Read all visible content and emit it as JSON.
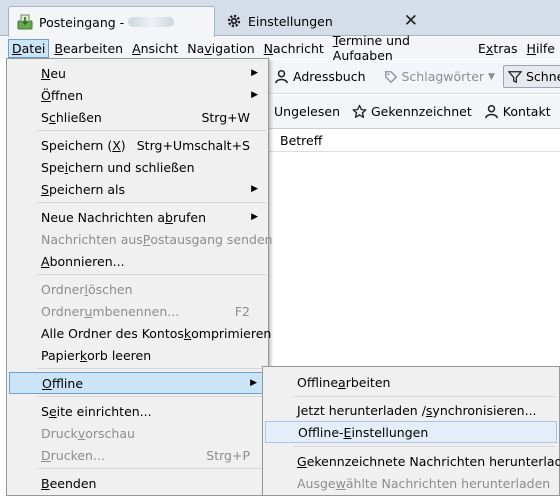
{
  "tabs": [
    {
      "label": "Posteingang -",
      "icon": "inbox-download-icon"
    },
    {
      "label": "Einstellungen",
      "icon": "gear-icon",
      "close": "✕"
    }
  ],
  "menubar": {
    "items": [
      {
        "pre": "",
        "u": "D",
        "post": "atei"
      },
      {
        "pre": "",
        "u": "B",
        "post": "earbeiten"
      },
      {
        "pre": "",
        "u": "A",
        "post": "nsicht"
      },
      {
        "pre": "Na",
        "u": "v",
        "post": "igation"
      },
      {
        "pre": "",
        "u": "N",
        "post": "achricht"
      },
      {
        "pre": "",
        "u": "T",
        "post": "ermine und Aufgaben"
      },
      {
        "pre": "E",
        "u": "x",
        "post": "tras"
      },
      {
        "pre": "",
        "u": "H",
        "post": "ilfe"
      }
    ]
  },
  "toolbar": {
    "addressbook": "Adressbuch",
    "tags": "Schlagwörter",
    "quickfilter": "Schnellfi",
    "unread": "Ungelesen",
    "starred": "Gekennzeichnet",
    "contact": "Kontakt"
  },
  "columns": {
    "subject": "Betreff"
  },
  "file_menu": {
    "items": [
      {
        "pre": "",
        "u": "N",
        "post": "eu",
        "shortcut": "",
        "submenu": true,
        "disabled": false
      },
      {
        "pre": "",
        "u": "Ö",
        "post": "ffnen",
        "shortcut": "",
        "submenu": true,
        "disabled": false
      },
      {
        "pre": "S",
        "u": "c",
        "post": "hließen",
        "shortcut": "Strg+W",
        "submenu": false,
        "disabled": false
      },
      {
        "pre": "Speichern (",
        "u": "X",
        "post": ")",
        "shortcut": "Strg+Umschalt+S",
        "submenu": false,
        "disabled": false
      },
      {
        "pre": "Spe",
        "u": "i",
        "post": "chern und schließen",
        "shortcut": "",
        "submenu": false,
        "disabled": false
      },
      {
        "pre": "",
        "u": "S",
        "post": "peichern als",
        "shortcut": "",
        "submenu": true,
        "disabled": false
      },
      {
        "pre": "Neue Nachrichten a",
        "u": "b",
        "post": "rufen",
        "shortcut": "",
        "submenu": true,
        "disabled": false
      },
      {
        "pre": "Nachrichten aus ",
        "u": "P",
        "post": "ostausgang senden",
        "shortcut": "",
        "submenu": false,
        "disabled": true
      },
      {
        "pre": "",
        "u": "A",
        "post": "bonnieren...",
        "shortcut": "",
        "submenu": false,
        "disabled": false
      },
      {
        "pre": "Ordner ",
        "u": "l",
        "post": "öschen",
        "shortcut": "",
        "submenu": false,
        "disabled": true
      },
      {
        "pre": "Ordner ",
        "u": "u",
        "post": "mbenennen...",
        "shortcut": "F2",
        "submenu": false,
        "disabled": true
      },
      {
        "pre": "Alle Ordner des Kontos ",
        "u": "k",
        "post": "omprimieren",
        "shortcut": "",
        "submenu": false,
        "disabled": false
      },
      {
        "pre": "Papier",
        "u": "k",
        "post": "orb leeren",
        "shortcut": "",
        "submenu": false,
        "disabled": false
      },
      {
        "pre": "",
        "u": "O",
        "post": "ffline",
        "shortcut": "",
        "submenu": true,
        "disabled": false
      },
      {
        "pre": "S",
        "u": "e",
        "post": "ite einrichten...",
        "shortcut": "",
        "submenu": false,
        "disabled": false
      },
      {
        "pre": "Druck",
        "u": "v",
        "post": "orschau",
        "shortcut": "",
        "submenu": false,
        "disabled": true
      },
      {
        "pre": "",
        "u": "D",
        "post": "rucken...",
        "shortcut": "Strg+P",
        "submenu": false,
        "disabled": true
      },
      {
        "pre": "",
        "u": "B",
        "post": "eenden",
        "shortcut": "",
        "submenu": false,
        "disabled": false
      }
    ]
  },
  "offline_menu": {
    "items": [
      {
        "pre": "Offline ",
        "u": "a",
        "post": "rbeiten",
        "disabled": false
      },
      {
        "pre": "Jetzt herunterladen / ",
        "u": "s",
        "post": "ynchronisieren...",
        "disabled": false
      },
      {
        "pre": "Offline-",
        "u": "E",
        "post": "instellungen",
        "disabled": false
      },
      {
        "pre": "",
        "u": "G",
        "post": "ekennzeichnete Nachrichten herunterladen",
        "disabled": false
      },
      {
        "pre": "Ausge",
        "u": "w",
        "post": "ählte Nachrichten herunterladen",
        "disabled": true
      }
    ]
  }
}
